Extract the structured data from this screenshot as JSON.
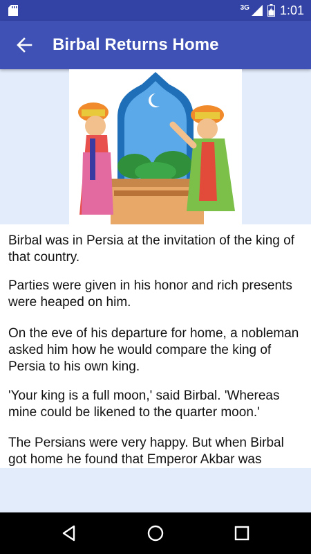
{
  "status_bar": {
    "network": "3G",
    "time": "1:01",
    "icons": [
      "sd-card-icon",
      "signal-icon",
      "battery-icon"
    ]
  },
  "app_bar": {
    "title": "Birbal Returns Home",
    "back_icon": "arrow-back-icon"
  },
  "story": {
    "paragraphs": [
      "Birbal was in Persia at the invitation of the king of that country.",
      "Parties were given in his honor and rich presents were heaped on him.",
      "On the eve of his departure for home, a nobleman asked him how he would compare the king of Persia to his own king.",
      "'Your king is a full moon,' said Birbal. 'Whereas mine could be likened to the quarter moon.'",
      "The Persians were very happy. But when Birbal got home he found that Emperor Akbar was"
    ]
  },
  "nav_bar": {
    "icons": [
      "back-triangle-icon",
      "home-circle-icon",
      "recents-square-icon"
    ]
  },
  "colors": {
    "status_bar": "#3343a5",
    "app_bar": "#3f51b5",
    "page_background": "#e3ecfb",
    "nav_bar": "#000000"
  }
}
